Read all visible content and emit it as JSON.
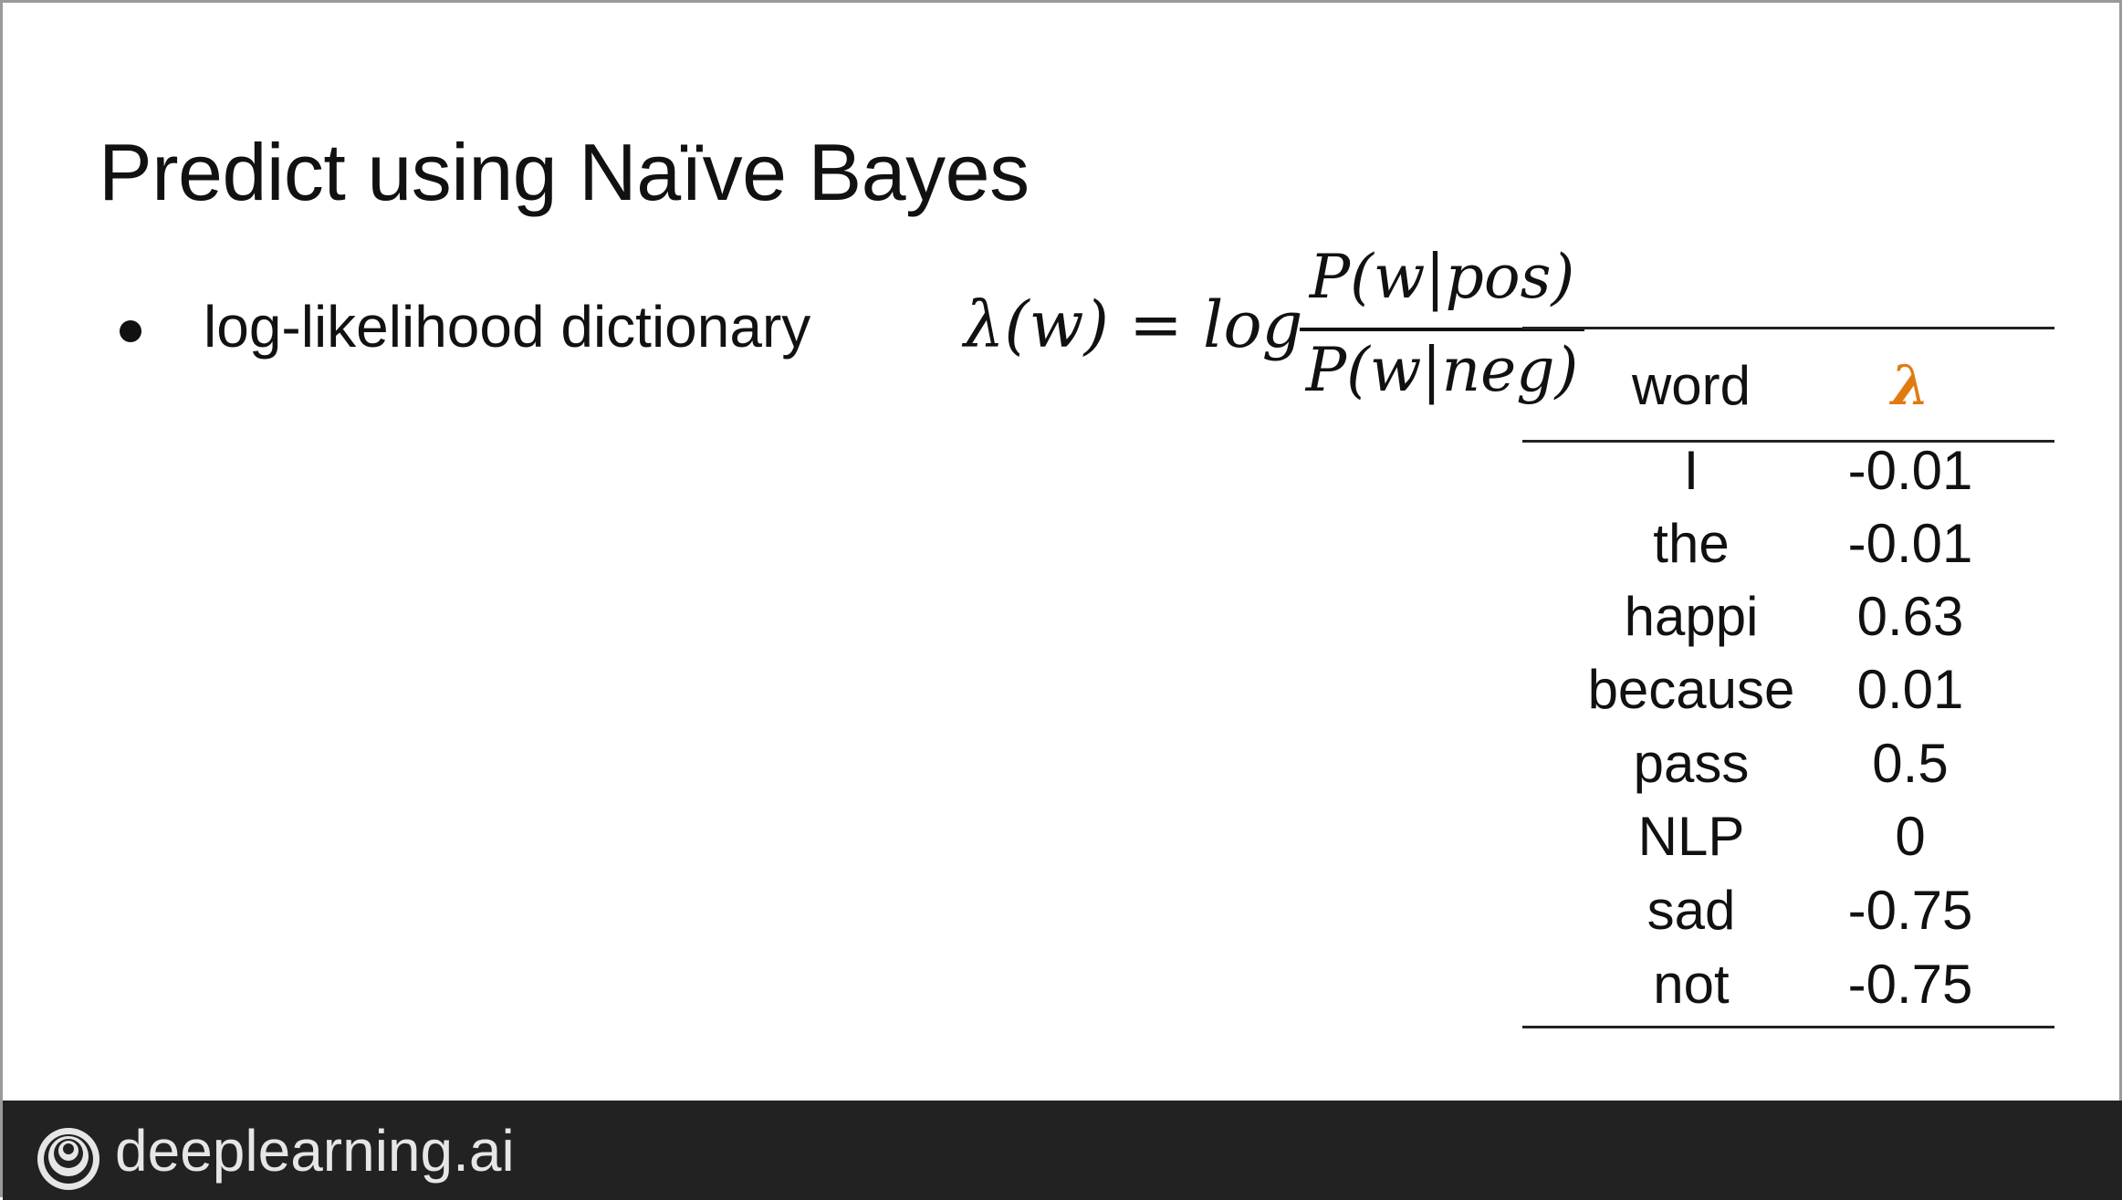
{
  "slide": {
    "title": "Predict using Naïve Bayes",
    "bullet": "log-likelihood dictionary",
    "formula": {
      "lhs": "λ(w) = log",
      "numerator": "P(w|pos)",
      "denominator": "P(w|neg)"
    }
  },
  "table": {
    "headers": {
      "word": "word",
      "lambda": "λ"
    },
    "lambda_color": "#e07b12",
    "rows": [
      {
        "word": "I",
        "value": "-0.01"
      },
      {
        "word": "the",
        "value": "-0.01"
      },
      {
        "word": "happi",
        "value": "0.63"
      },
      {
        "word": "because",
        "value": "0.01"
      },
      {
        "word": "pass",
        "value": "0.5"
      },
      {
        "word": "NLP",
        "value": "0"
      },
      {
        "word": "sad",
        "value": "-0.75"
      },
      {
        "word": "not",
        "value": "-0.75"
      }
    ]
  },
  "footer": {
    "brand": "deeplearning.ai",
    "logo_icon": "deeplearning-logo-icon"
  }
}
